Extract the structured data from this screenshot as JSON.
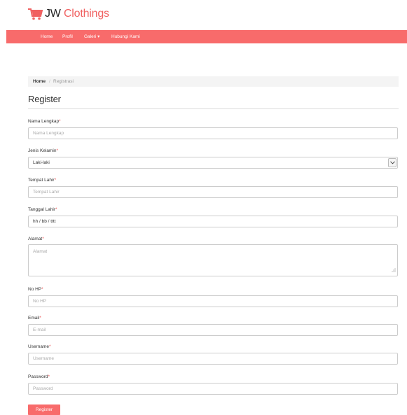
{
  "brand": {
    "name_part1": "JW",
    "name_part2": "Clothings"
  },
  "nav": [
    "Home",
    "Profil",
    "Galeri ▾",
    "Hubungi Kami"
  ],
  "breadcrumb": {
    "home": "Home",
    "separator": "/",
    "current": "Registrasi"
  },
  "page_title": "Register",
  "form": {
    "required_mark": "*",
    "nama": {
      "label": "Nama Lengkap",
      "placeholder": "Nama Lengkap"
    },
    "jenis_kelamin": {
      "label": "Jenis Kelamin",
      "value": "Laki-laki"
    },
    "tempat_lahir": {
      "label": "Tempat Lahir",
      "placeholder": "Tempat Lahir"
    },
    "tanggal_lahir": {
      "label": "Tanggal Lahir",
      "value": "hh / bb / tttt"
    },
    "alamat": {
      "label": "Alamat",
      "placeholder": "Alamat"
    },
    "no_hp": {
      "label": "No HP",
      "placeholder": "No HP"
    },
    "email": {
      "label": "Email",
      "placeholder": "E-mail"
    },
    "username": {
      "label": "Username",
      "placeholder": "Username"
    },
    "password": {
      "label": "Password",
      "placeholder": "Password"
    },
    "submit_label": "Register"
  },
  "colors": {
    "accent": "#f86b6b",
    "brand_text": "#f06161"
  },
  "icons": {
    "logo": "shopping-cart-icon",
    "select": "chevron-down-icon",
    "resize": "resize-grip-icon"
  }
}
